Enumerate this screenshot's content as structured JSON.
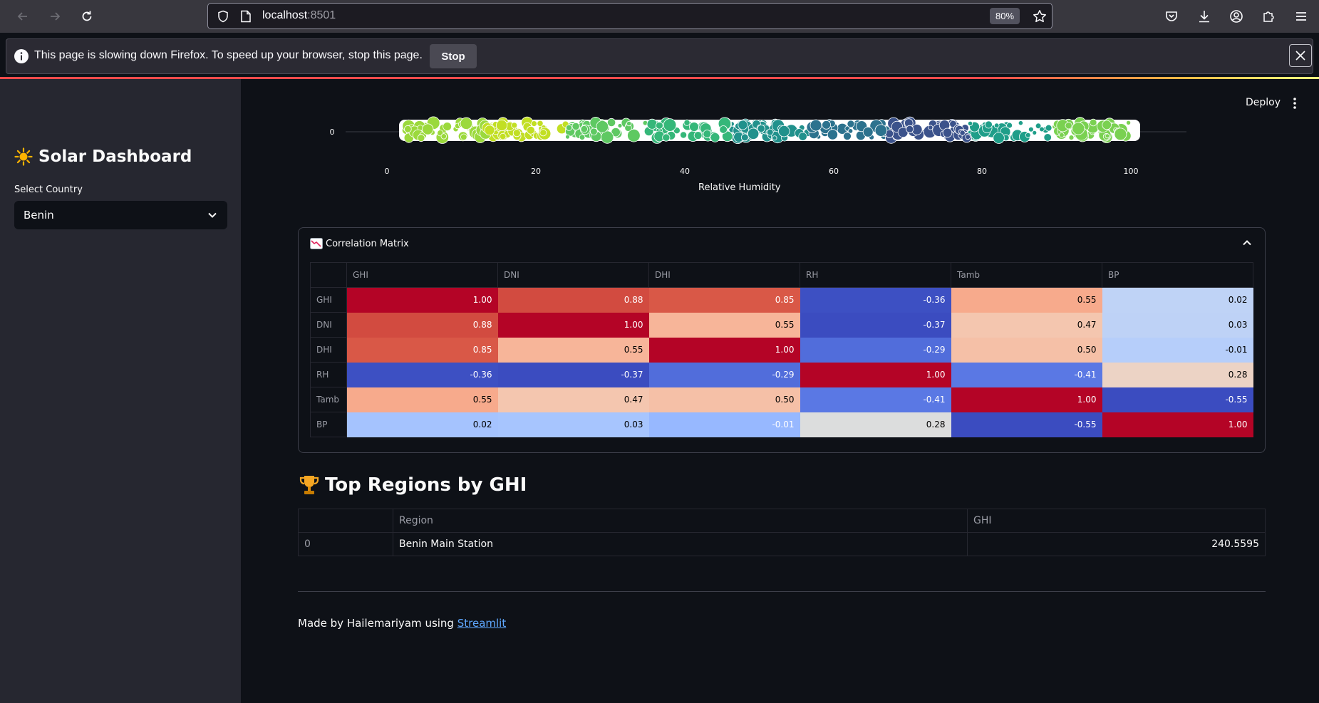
{
  "browser": {
    "url_host": "localhost",
    "url_port": ":8501",
    "zoom": "80%",
    "notification_text": "This page is slowing down Firefox. To speed up your browser, stop this page.",
    "notification_button": "Stop"
  },
  "sidebar": {
    "title": "Solar Dashboard",
    "select_label": "Select Country",
    "select_value": "Benin"
  },
  "header": {
    "deploy_label": "Deploy"
  },
  "scatter": {
    "y_tick": "0",
    "x_ticks": [
      "0",
      "20",
      "40",
      "60",
      "80",
      "100"
    ],
    "x_title": "Relative Humidity"
  },
  "correlation": {
    "title": "Correlation Matrix",
    "columns": [
      "GHI",
      "DNI",
      "DHI",
      "RH",
      "Tamb",
      "BP"
    ],
    "rows": [
      {
        "label": "GHI",
        "values": [
          "1.00",
          "0.88",
          "0.85",
          "-0.36",
          "0.55",
          "0.02"
        ]
      },
      {
        "label": "DNI",
        "values": [
          "0.88",
          "1.00",
          "0.55",
          "-0.37",
          "0.47",
          "0.03"
        ]
      },
      {
        "label": "DHI",
        "values": [
          "0.85",
          "0.55",
          "1.00",
          "-0.29",
          "0.50",
          "-0.01"
        ]
      },
      {
        "label": "RH",
        "values": [
          "-0.36",
          "-0.37",
          "-0.29",
          "1.00",
          "-0.41",
          "0.28"
        ]
      },
      {
        "label": "Tamb",
        "values": [
          "0.55",
          "0.47",
          "0.50",
          "-0.41",
          "1.00",
          "-0.55"
        ]
      },
      {
        "label": "BP",
        "values": [
          "0.02",
          "0.03",
          "-0.01",
          "0.28",
          "-0.55",
          "1.00"
        ]
      }
    ],
    "cell_colors": [
      [
        "#b40426",
        "#d24b40",
        "#d95847",
        "#3d50c3",
        "#f7aa8c",
        "#bfd3f6"
      ],
      [
        "#d24b40",
        "#b40426",
        "#f7b599",
        "#3b4cc0",
        "#f4c6af",
        "#bed2f6"
      ],
      [
        "#d95847",
        "#f7b599",
        "#b40426",
        "#516ddb",
        "#f5c0a7",
        "#b6cefa"
      ],
      [
        "#3d50c3",
        "#3b4cc0",
        "#516ddb",
        "#b40426",
        "#5a78e4",
        "#ecd3c5"
      ],
      [
        "#f7aa8c",
        "#f4c6af",
        "#f5c0a7",
        "#5a78e4",
        "#b40426",
        "#3b4cc0"
      ],
      [
        "#a5c3fe",
        "#a7c5fe",
        "#97b8ff",
        "#dcdddd",
        "#3b4cc0",
        "#b40426"
      ]
    ],
    "text_colors": [
      [
        "#ffffff",
        "#ffffff",
        "#ffffff",
        "#ffffff",
        "#000000",
        "#000000"
      ],
      [
        "#ffffff",
        "#ffffff",
        "#000000",
        "#ffffff",
        "#000000",
        "#000000"
      ],
      [
        "#ffffff",
        "#000000",
        "#ffffff",
        "#ffffff",
        "#000000",
        "#000000"
      ],
      [
        "#ffffff",
        "#ffffff",
        "#ffffff",
        "#ffffff",
        "#ffffff",
        "#000000"
      ],
      [
        "#000000",
        "#000000",
        "#000000",
        "#ffffff",
        "#ffffff",
        "#ffffff"
      ],
      [
        "#000000",
        "#000000",
        "#ffffff",
        "#000000",
        "#ffffff",
        "#ffffff"
      ]
    ]
  },
  "top_regions": {
    "title": "Top Regions by GHI",
    "columns": [
      "",
      "Region",
      "GHI"
    ],
    "rows": [
      {
        "index": "0",
        "region": "Benin Main Station",
        "ghi": "240.5595"
      }
    ]
  },
  "footer": {
    "text": "Made by Hailemariyam using ",
    "link": "Streamlit"
  }
}
